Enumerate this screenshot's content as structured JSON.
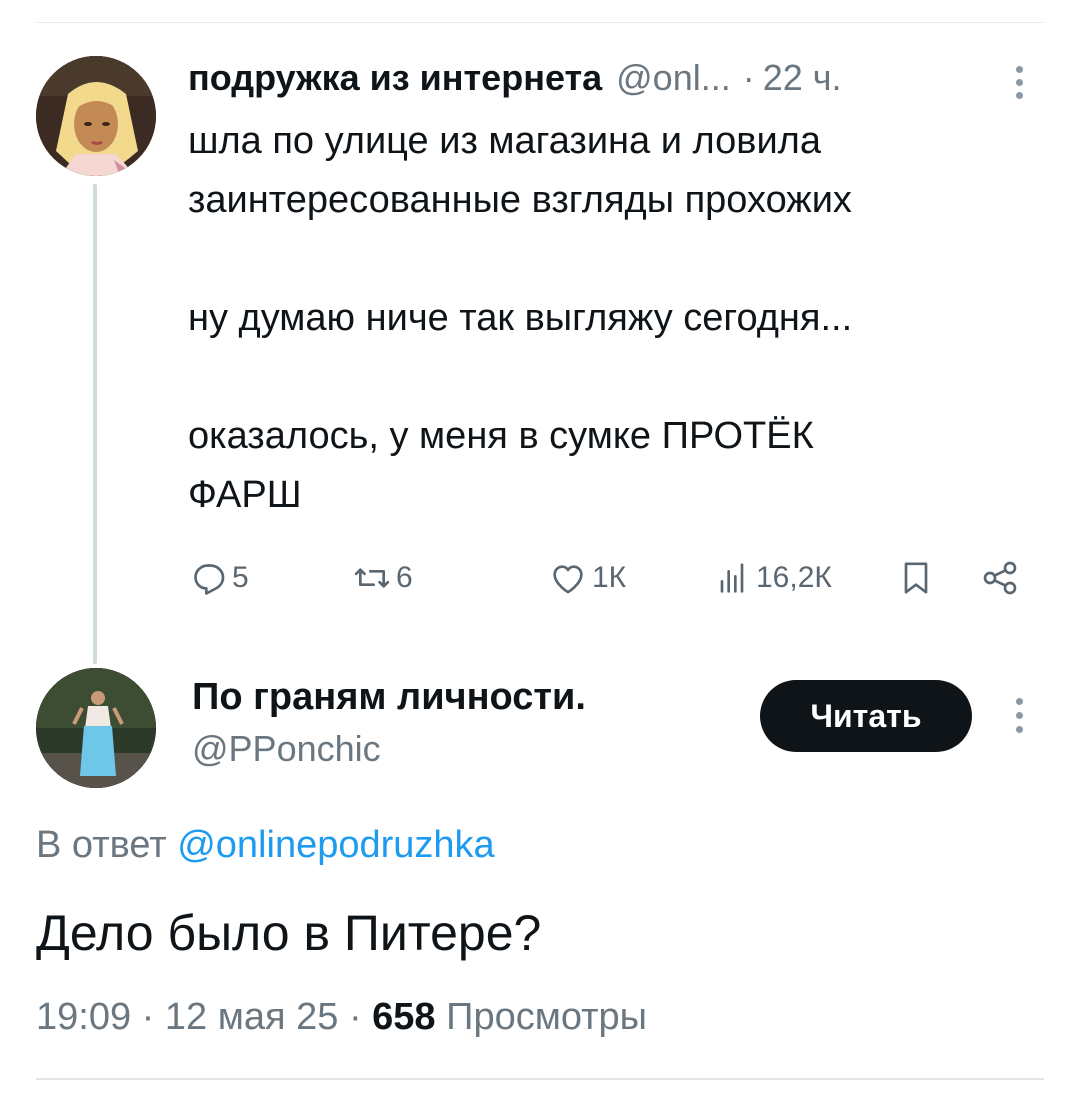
{
  "parent": {
    "author_name": "подружка из интернета",
    "author_handle": "@onl...",
    "separator": "·",
    "time": "22 ч.",
    "text_lines": [
      "шла по улице из магазина и ловила",
      "заинтересованные взгляды прохожих",
      "ну думаю ниче так выгляжу сегодня...",
      "оказалось, у меня в сумке ПРОТЁК",
      "ФАРШ"
    ],
    "actions": {
      "replies": "5",
      "retweets": "6",
      "likes": "1К",
      "views": "16,2К"
    },
    "icons": [
      "reply-icon",
      "retweet-icon",
      "like-icon",
      "views-icon",
      "bookmark-icon",
      "share-icon",
      "more-icon"
    ]
  },
  "reply": {
    "author_name": "По граням личности.",
    "author_handle": "@PPonchic",
    "follow_label": "Читать",
    "reply_to_label": "В ответ",
    "reply_to_mention": "@onlinepodruzhka",
    "text": "Дело было в Питере?",
    "time": "19:09",
    "date": "12 мая 25",
    "sep": "·",
    "views_count": "658",
    "views_label": "Просмотры"
  },
  "colors": {
    "text": "#0f1419",
    "secondary": "#6b7780",
    "link": "#1d9bf0",
    "thread_line": "#cfd9de",
    "button_bg": "#0f1419"
  }
}
